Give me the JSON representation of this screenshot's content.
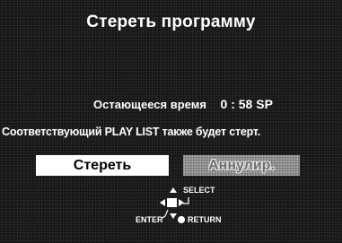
{
  "dialog": {
    "title": "Стереть программу",
    "remaining_label": "Остающееся время",
    "remaining_value": "0 : 58 SP",
    "notice": "Соответствующий PLAY LIST также будет стерт."
  },
  "buttons": {
    "erase_label": "Стереть",
    "cancel_label": "Аннулир."
  },
  "navigation": {
    "select_label": "SELECT",
    "enter_label": "ENTER",
    "return_label": "RETURN",
    "icons": [
      "cursor-arrows-icon",
      "enter-hook-icon",
      "return-dot-icon"
    ]
  },
  "colors": {
    "background": "#151515",
    "text": "#ffffff",
    "erase_button_bg": "#ffffff",
    "cancel_button_bg": "#8e8e8e"
  }
}
